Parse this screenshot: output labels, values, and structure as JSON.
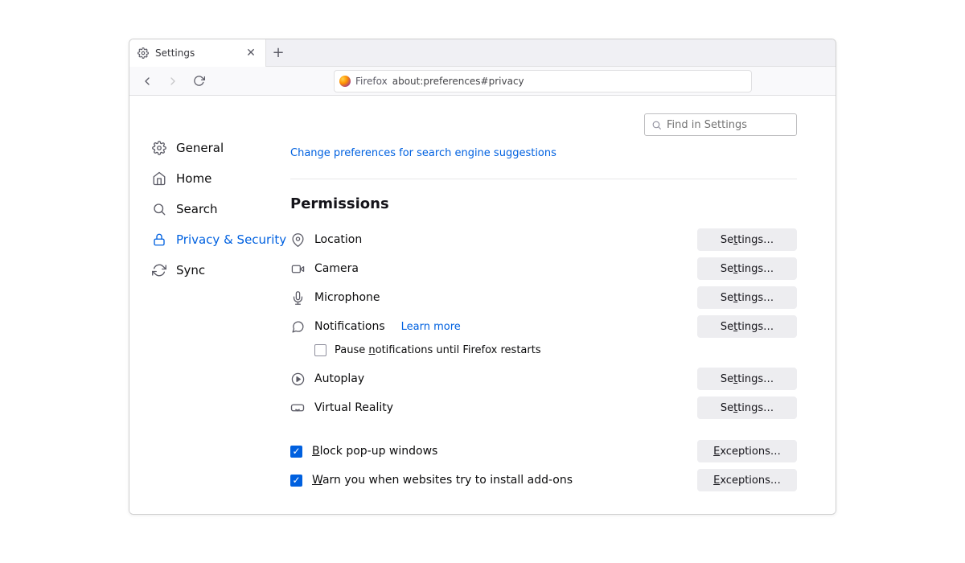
{
  "tab": {
    "title": "Settings"
  },
  "urlbar": {
    "identity": "Firefox",
    "url": "about:preferences#privacy"
  },
  "search": {
    "placeholder": "Find in Settings"
  },
  "sidebar": {
    "items": [
      {
        "label": "General"
      },
      {
        "label": "Home"
      },
      {
        "label": "Search"
      },
      {
        "label": "Privacy & Security"
      },
      {
        "label": "Sync"
      }
    ]
  },
  "panel": {
    "truncated_link": "Change preferences for search engine suggestions",
    "heading": "Permissions",
    "perms": {
      "location": {
        "label": "Location",
        "button": "Settings…"
      },
      "camera": {
        "label": "Camera",
        "button": "Settings…"
      },
      "microphone": {
        "label": "Microphone",
        "button": "Settings…"
      },
      "notifications": {
        "label": "Notifications",
        "learn": "Learn more",
        "button": "Settings…",
        "pause": "Pause notifications until Firefox restarts"
      },
      "autoplay": {
        "label": "Autoplay",
        "button": "Settings…"
      },
      "vr": {
        "label": "Virtual Reality",
        "button": "Settings…"
      }
    },
    "popups": {
      "label": "Block pop-up windows",
      "button": "Exceptions…"
    },
    "addons": {
      "label": "Warn you when websites try to install add-ons",
      "button": "Exceptions…"
    }
  }
}
